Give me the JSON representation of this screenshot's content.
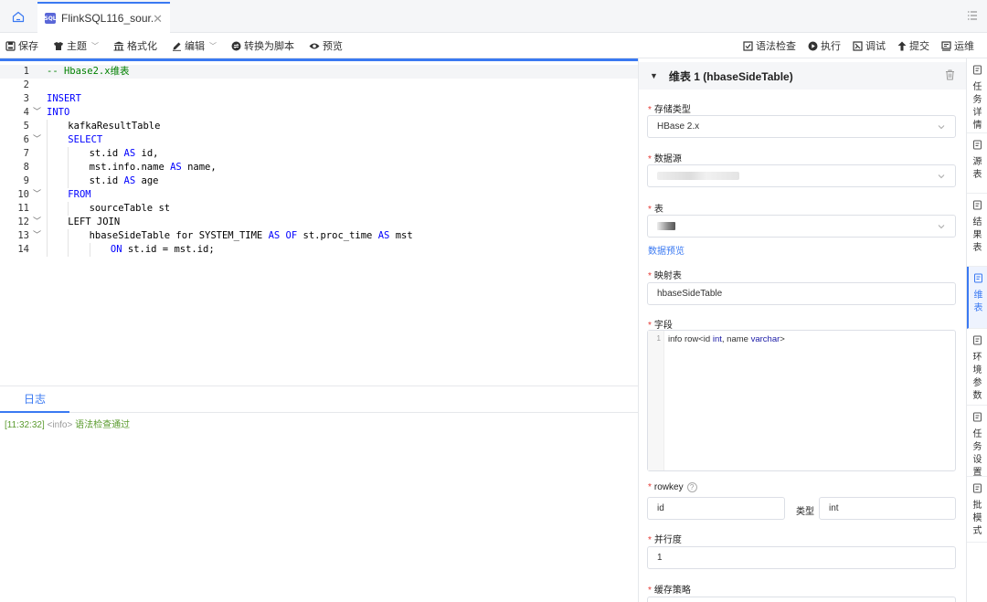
{
  "tab": {
    "label": "FlinkSQL116_sour..."
  },
  "toolbar": {
    "left": [
      {
        "label": "保存",
        "icon": "save-icon"
      },
      {
        "label": "主题",
        "icon": "theme-icon",
        "dropdown": true
      },
      {
        "label": "格式化",
        "icon": "format-icon"
      },
      {
        "label": "编辑",
        "icon": "edit-icon",
        "dropdown": true
      },
      {
        "label": "转换为脚本",
        "icon": "convert-icon"
      },
      {
        "label": "预览",
        "icon": "preview-icon"
      }
    ],
    "right": [
      {
        "label": "语法检查",
        "icon": "syntax-check-icon"
      },
      {
        "label": "执行",
        "icon": "run-icon"
      },
      {
        "label": "调试",
        "icon": "debug-icon"
      },
      {
        "label": "提交",
        "icon": "submit-icon"
      },
      {
        "label": "运维",
        "icon": "ops-icon"
      }
    ]
  },
  "editor": {
    "lines": [
      {
        "n": "1",
        "fold": false,
        "indent": 0,
        "tokens": [
          [
            "cm",
            "-- Hbase2.x维表"
          ]
        ]
      },
      {
        "n": "2",
        "fold": false,
        "indent": 0,
        "tokens": []
      },
      {
        "n": "3",
        "fold": false,
        "indent": 0,
        "tokens": [
          [
            "kw",
            "INSERT"
          ]
        ]
      },
      {
        "n": "4",
        "fold": true,
        "indent": 0,
        "tokens": [
          [
            "kw",
            "INTO"
          ]
        ]
      },
      {
        "n": "5",
        "fold": false,
        "indent": 1,
        "tokens": [
          [
            "",
            "kafkaResultTable"
          ]
        ]
      },
      {
        "n": "6",
        "fold": true,
        "indent": 1,
        "tokens": [
          [
            "kw",
            "SELECT"
          ]
        ]
      },
      {
        "n": "7",
        "fold": false,
        "indent": 2,
        "tokens": [
          [
            "",
            "st.id "
          ],
          [
            "kw",
            "AS"
          ],
          [
            "",
            " id,"
          ]
        ]
      },
      {
        "n": "8",
        "fold": false,
        "indent": 2,
        "tokens": [
          [
            "",
            "mst.info.name "
          ],
          [
            "kw",
            "AS"
          ],
          [
            "",
            " name,"
          ]
        ]
      },
      {
        "n": "9",
        "fold": false,
        "indent": 2,
        "tokens": [
          [
            "",
            "st.id "
          ],
          [
            "kw",
            "AS"
          ],
          [
            "",
            " age"
          ]
        ]
      },
      {
        "n": "10",
        "fold": true,
        "indent": 1,
        "tokens": [
          [
            "kw",
            "FROM"
          ]
        ]
      },
      {
        "n": "11",
        "fold": false,
        "indent": 2,
        "tokens": [
          [
            "",
            "sourceTable st"
          ]
        ]
      },
      {
        "n": "12",
        "fold": true,
        "indent": 1,
        "tokens": [
          [
            "",
            "LEFT JOIN"
          ]
        ]
      },
      {
        "n": "13",
        "fold": true,
        "indent": 2,
        "tokens": [
          [
            "",
            "hbaseSideTable for SYSTEM_TIME "
          ],
          [
            "kw",
            "AS"
          ],
          [
            "",
            " "
          ],
          [
            "kw",
            "OF"
          ],
          [
            "",
            " st.proc_time "
          ],
          [
            "kw",
            "AS"
          ],
          [
            "",
            " mst"
          ]
        ]
      },
      {
        "n": "14",
        "fold": false,
        "indent": 3,
        "tokens": [
          [
            "kw",
            "ON"
          ],
          [
            "",
            " st.id = mst.id;"
          ]
        ]
      }
    ]
  },
  "log": {
    "tab": "日志",
    "time": "[11:32:32]",
    "level": "<info>",
    "message": "语法检查通过"
  },
  "panel": {
    "title": "维表 1 (hbaseSideTable)",
    "storage_type_label": "存储类型",
    "storage_type_value": "HBase 2.x",
    "datasource_label": "数据源",
    "table_label": "表",
    "data_preview_link": "数据预览",
    "mapping_table_label": "映射表",
    "mapping_table_value": "hbaseSideTable",
    "fields_label": "字段",
    "fields_line_no": "1",
    "fields_code_a": "info row<id ",
    "fields_code_b": "int",
    "fields_code_c": ", name ",
    "fields_code_d": "varchar",
    "fields_code_e": ">",
    "rowkey_label": "rowkey",
    "rowkey_value": "id",
    "rowkey_type_label": "类型",
    "rowkey_type_value": "int",
    "parallelism_label": "并行度",
    "parallelism_value": "1",
    "cache_label": "缓存策略"
  },
  "side_tabs": [
    {
      "label": "任务详情",
      "icon": "task-detail-icon"
    },
    {
      "label": "源表",
      "icon": "source-table-icon"
    },
    {
      "label": "结果表",
      "icon": "result-table-icon"
    },
    {
      "label": "维表",
      "icon": "dimension-table-icon",
      "active": true
    },
    {
      "label": "环境参数",
      "icon": "env-params-icon"
    },
    {
      "label": "任务设置",
      "icon": "task-settings-icon"
    },
    {
      "label": "批模式",
      "icon": "batch-mode-icon"
    }
  ],
  "colors": {
    "accent": "#3a79f2",
    "keyword": "#0000ff",
    "comment": "#008000",
    "log_ok": "#5b9b2f",
    "required": "#e53935"
  }
}
